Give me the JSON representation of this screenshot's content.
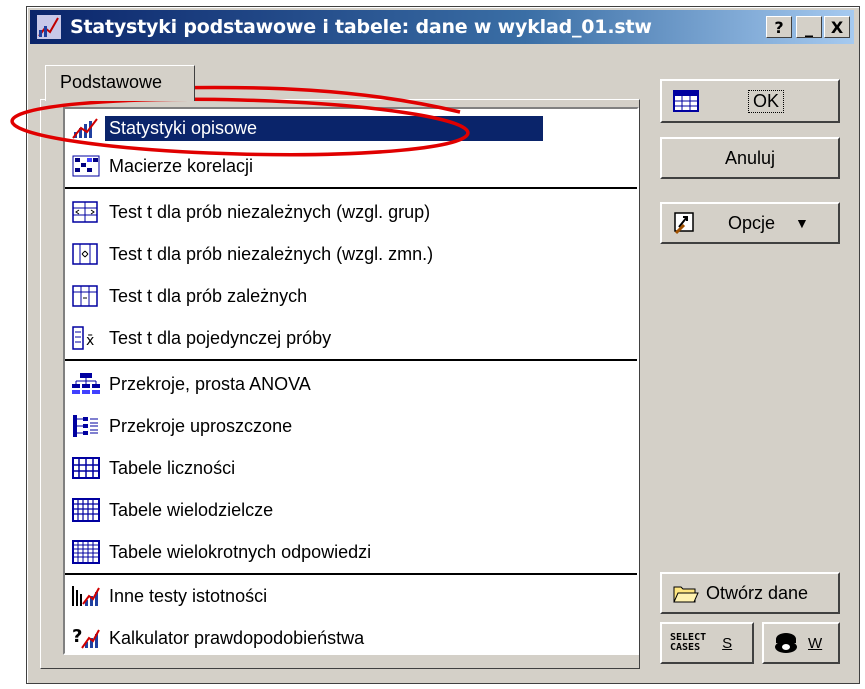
{
  "window": {
    "title": "Statystyki podstawowe i tabele: dane w wyklad_01.stw",
    "help_label": "?",
    "minimize_label": "_",
    "close_label": "X"
  },
  "tab": {
    "label": "Podstawowe"
  },
  "list": {
    "items": [
      {
        "label": "Statystyki opisowe",
        "icon": "descriptive-stats-icon",
        "selected": true
      },
      {
        "label": "Macierze korelacji",
        "icon": "correlation-matrix-icon"
      },
      {
        "label": "Test t dla prób niezależnych (wzgl. grup)",
        "icon": "ttest-groups-icon"
      },
      {
        "label": "Test t dla prób niezależnych (wzgl. zmn.)",
        "icon": "ttest-variables-icon"
      },
      {
        "label": "Test t dla prób zależnych",
        "icon": "ttest-dependent-icon"
      },
      {
        "label": "Test t dla pojedynczej próby",
        "icon": "ttest-single-icon"
      },
      {
        "label": "Przekroje, prosta ANOVA",
        "icon": "breakdown-anova-icon"
      },
      {
        "label": "Przekroje uproszczone",
        "icon": "breakdown-simple-icon"
      },
      {
        "label": "Tabele liczności",
        "icon": "frequency-table-icon"
      },
      {
        "label": "Tabele wielodzielcze",
        "icon": "crosstab-icon"
      },
      {
        "label": "Tabele wielokrotnych odpowiedzi",
        "icon": "multiple-response-icon"
      },
      {
        "label": "Inne testy istotności",
        "icon": "other-tests-icon"
      },
      {
        "label": "Kalkulator prawdopodobieństwa",
        "icon": "probability-calculator-icon"
      }
    ]
  },
  "buttons": {
    "ok": "OK",
    "cancel": "Anuluj",
    "options": "Opcje",
    "open_data": "Otwórz dane",
    "select_cases_line1": "SELECT",
    "select_cases_line2": "CASES",
    "select_cases_key": "S",
    "weight_key": "W"
  },
  "colors": {
    "title_gradient_start": "#0a246a",
    "title_gradient_end": "#a6caf0",
    "selection": "#0a246a",
    "annotation": "#e00000"
  }
}
